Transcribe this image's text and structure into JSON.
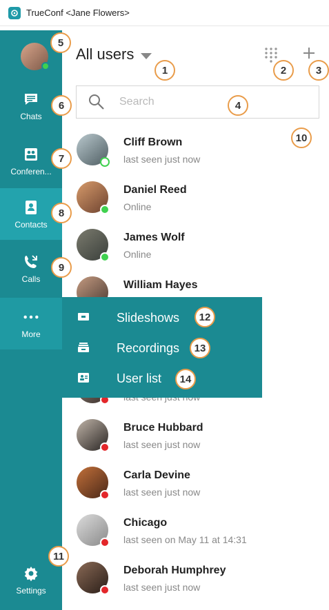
{
  "window": {
    "title": "TrueConf <Jane Flowers>"
  },
  "header": {
    "title": "All users"
  },
  "search": {
    "placeholder": "Search"
  },
  "nav": [
    {
      "label": "Chats",
      "icon": "chat-bubble-icon"
    },
    {
      "label": "Conferen...",
      "icon": "conference-icon"
    },
    {
      "label": "Contacts",
      "icon": "contacts-book-icon"
    },
    {
      "label": "Calls",
      "icon": "phone-calls-icon"
    },
    {
      "label": "More",
      "icon": "more-dots-icon"
    }
  ],
  "settings": {
    "label": "Settings"
  },
  "contacts": [
    {
      "name": "Cliff Brown",
      "status": "last seen just now",
      "presence": "away"
    },
    {
      "name": "Daniel Reed",
      "status": "Online",
      "presence": "online"
    },
    {
      "name": "James Wolf",
      "status": "Online",
      "presence": "online"
    },
    {
      "name": "William Hayes",
      "status": "",
      "presence": ""
    },
    {
      "name": "",
      "status": "last seen just now",
      "presence": "offline"
    },
    {
      "name": "Bruce Hubbard",
      "status": "last seen just now",
      "presence": "offline"
    },
    {
      "name": "Carla Devine",
      "status": "last seen just now",
      "presence": "offline"
    },
    {
      "name": "Chicago",
      "status": "last seen on May 11 at 14:31",
      "presence": "offline"
    },
    {
      "name": "Deborah Humphrey",
      "status": "last seen just now",
      "presence": "offline"
    }
  ],
  "more_menu": [
    {
      "label": "Slideshows",
      "icon": "slideshow-icon"
    },
    {
      "label": "Recordings",
      "icon": "recordings-icon"
    },
    {
      "label": "User list",
      "icon": "user-list-icon"
    }
  ],
  "callouts": [
    "1",
    "2",
    "3",
    "4",
    "5",
    "6",
    "7",
    "8",
    "9",
    "10",
    "11",
    "12",
    "13",
    "14"
  ],
  "colors": {
    "sidebar": "#1b8a92",
    "sidebar_active": "#23a3ad",
    "online": "#3fd14f",
    "offline": "#e3262a",
    "callout_border": "#e99c4a"
  }
}
